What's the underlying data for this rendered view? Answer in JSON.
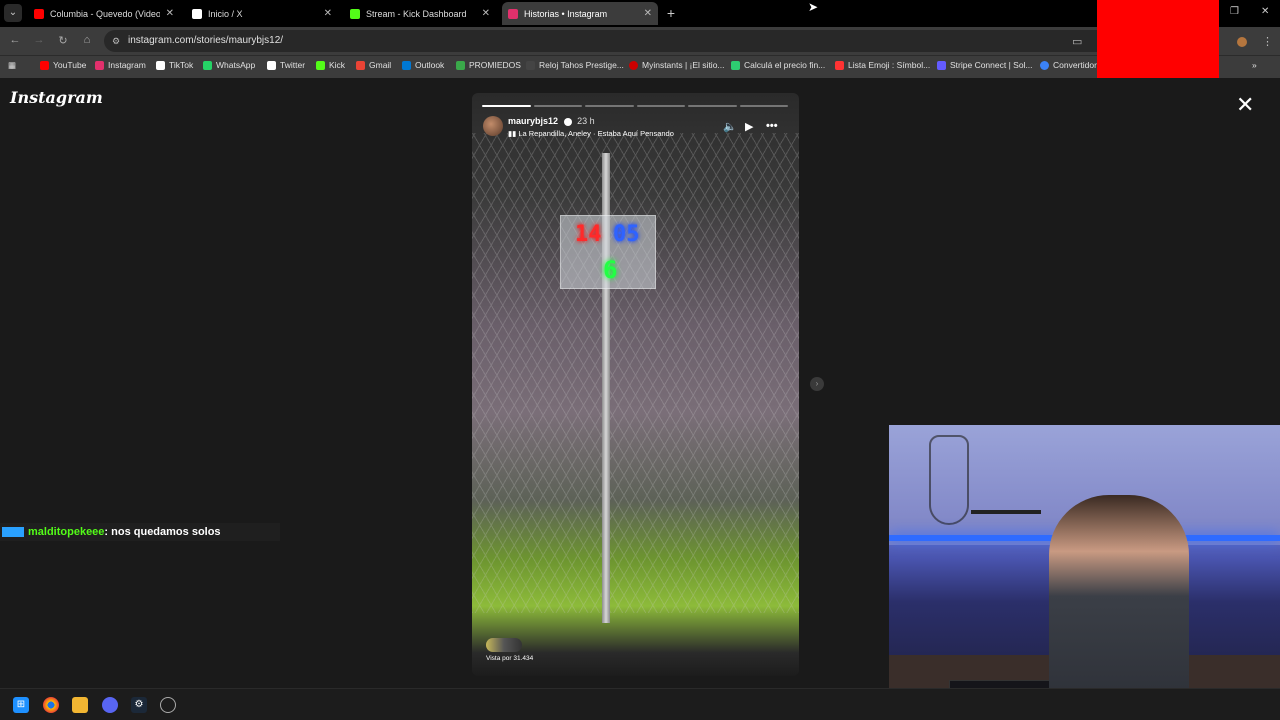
{
  "browser": {
    "tabs": [
      {
        "label": "Columbia - Quevedo (Video Of",
        "favicon_color": "#ff0000",
        "active": false
      },
      {
        "label": "Inicio / X",
        "favicon_color": "#ffffff",
        "active": false
      },
      {
        "label": "Stream - Kick Dashboard",
        "favicon_color": "#53fc18",
        "active": false
      },
      {
        "label": "Historias • Instagram",
        "favicon_color": "#e1306c",
        "active": true
      }
    ],
    "new_tab_label": "+",
    "url": "instagram.com/stories/maurybjs12/"
  },
  "bookmarks": [
    {
      "label": "YouTube",
      "color": "#ff0000"
    },
    {
      "label": "Instagram",
      "color": "#e1306c"
    },
    {
      "label": "TikTok",
      "color": "#ffffff"
    },
    {
      "label": "WhatsApp",
      "color": "#25d366"
    },
    {
      "label": "Twitter",
      "color": "#ffffff"
    },
    {
      "label": "Kick",
      "color": "#53fc18"
    },
    {
      "label": "Gmail",
      "color": "#ea4335"
    },
    {
      "label": "Outlook",
      "color": "#0078d4"
    },
    {
      "label": "PROMIEDOS",
      "color": "#3aa94a"
    },
    {
      "label": "Reloj Tahos Prestige...",
      "color": "#222222"
    },
    {
      "label": "Myinstants | ¡El sitio...",
      "color": "#cc0000"
    },
    {
      "label": "Calculá el precio fin...",
      "color": "#2ecc71"
    },
    {
      "label": "Lista Emoji : Símbol...",
      "color": "#ff3333"
    },
    {
      "label": "Stripe Connect | Sol...",
      "color": "#635bff"
    },
    {
      "label": "Convertidor",
      "color": "#3b82f6"
    }
  ],
  "instagram": {
    "logo": "Instagram",
    "story": {
      "username": "maurybjs12",
      "time": "23 h",
      "song": "La Repandilla, Aneley · Estaba Aquí Pensando",
      "views": "Vista por 31.434",
      "sign_top_left": "14",
      "sign_top_right": "05",
      "sign_bottom": "6"
    }
  },
  "chat": {
    "username": "malditopekeee",
    "message": ": nos quedamos solos"
  }
}
